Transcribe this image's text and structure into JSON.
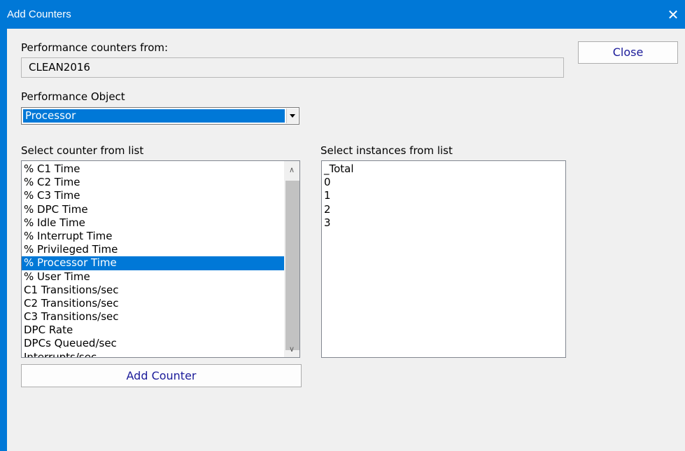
{
  "window": {
    "title": "Add Counters",
    "close_glyph": "✕"
  },
  "counters_from": {
    "label": "Performance counters from:",
    "value": "CLEAN2016"
  },
  "close_button": {
    "label": "Close"
  },
  "performance_object": {
    "label": "Performance Object",
    "selected": "Processor"
  },
  "counter_list": {
    "label": "Select counter from list",
    "items": [
      "% C1 Time",
      "% C2 Time",
      "% C3 Time",
      "% DPC Time",
      "% Idle Time",
      "% Interrupt Time",
      "% Privileged Time",
      "% Processor Time",
      "% User Time",
      "C1 Transitions/sec",
      "C2 Transitions/sec",
      "C3 Transitions/sec",
      "DPC Rate",
      "DPCs Queued/sec",
      "Interrupts/sec"
    ],
    "selected_index": 7,
    "scroll_up_glyph": "∧",
    "scroll_down_glyph": "∨"
  },
  "instance_list": {
    "label": "Select instances from list",
    "items": [
      "_Total",
      "0",
      "1",
      "2",
      "3"
    ]
  },
  "add_counter_button": {
    "label": "Add Counter"
  },
  "colors": {
    "accent": "#0078d7",
    "dialog_bg": "#f0f0f0",
    "button_text": "#1b1b9a"
  }
}
